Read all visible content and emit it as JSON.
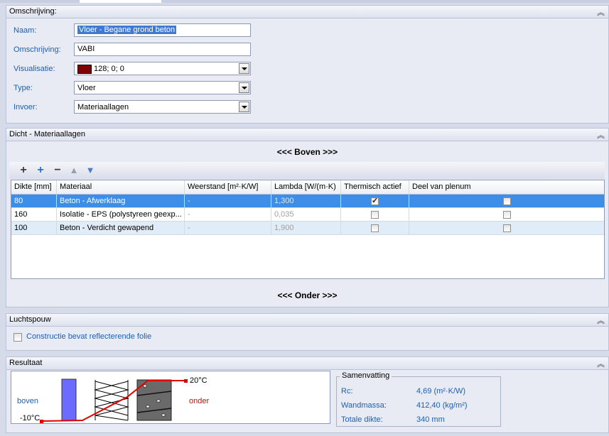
{
  "colors": {
    "accent": "#3d8ee8",
    "label": "#1c5fb2",
    "swatch": "#800000",
    "curve": "#e00000",
    "layer": "#6b6bff"
  },
  "omschrijving": {
    "title": "Omschrijving:",
    "labels": {
      "naam": "Naam:",
      "omschrijving": "Omschrijving:",
      "visualisatie": "Visualisatie:",
      "type": "Type:",
      "invoer": "Invoer:"
    },
    "naam": "Vloer - Begane grond beton",
    "omschrijving": "VABI",
    "visualisatie": "128; 0; 0",
    "type": "Vloer",
    "invoer": "Materiaallagen"
  },
  "dicht": {
    "title": "Dicht - Materiaallagen",
    "boven": "<<< Boven >>>",
    "onder": "<<< Onder >>>",
    "toolbar": [
      "add-icon",
      "insert-icon",
      "remove-icon",
      "move-up-icon",
      "move-down-icon"
    ],
    "columns": [
      "Dikte [mm]",
      "Materiaal",
      "Weerstand [m²·K/W]",
      "Lambda [W/(m·K)",
      "Thermisch actief",
      "Deel van plenum"
    ],
    "rows": [
      {
        "dikte": "80",
        "materiaal": "Beton - Afwerklaag",
        "weerstand": "-",
        "lambda": "1,300",
        "thermisch": true,
        "plenum": false
      },
      {
        "dikte": "160",
        "materiaal": "Isolatie - EPS (polystyreen geexp...",
        "weerstand": "-",
        "lambda": "0,035",
        "thermisch": false,
        "plenum": false
      },
      {
        "dikte": "100",
        "materiaal": "Beton - Verdicht gewapend",
        "weerstand": "-",
        "lambda": "1,900",
        "thermisch": false,
        "plenum": false
      }
    ]
  },
  "luchtspouw": {
    "title": "Luchtspouw",
    "checkbox_label": "Constructie bevat reflecterende folie",
    "checked": false
  },
  "resultaat": {
    "title": "Resultaat",
    "boven": "boven",
    "onder": "onder",
    "temp_top": "20°C",
    "temp_bottom": "-10°C",
    "summary": {
      "caption": "Samenvatting",
      "rows": [
        {
          "label": "Rc:",
          "value": "4,69 (m²·K/W)"
        },
        {
          "label": "Wandmassa:",
          "value": "412,40 (kg/m²)"
        },
        {
          "label": "Totale dikte:",
          "value": "340 mm"
        }
      ]
    }
  }
}
